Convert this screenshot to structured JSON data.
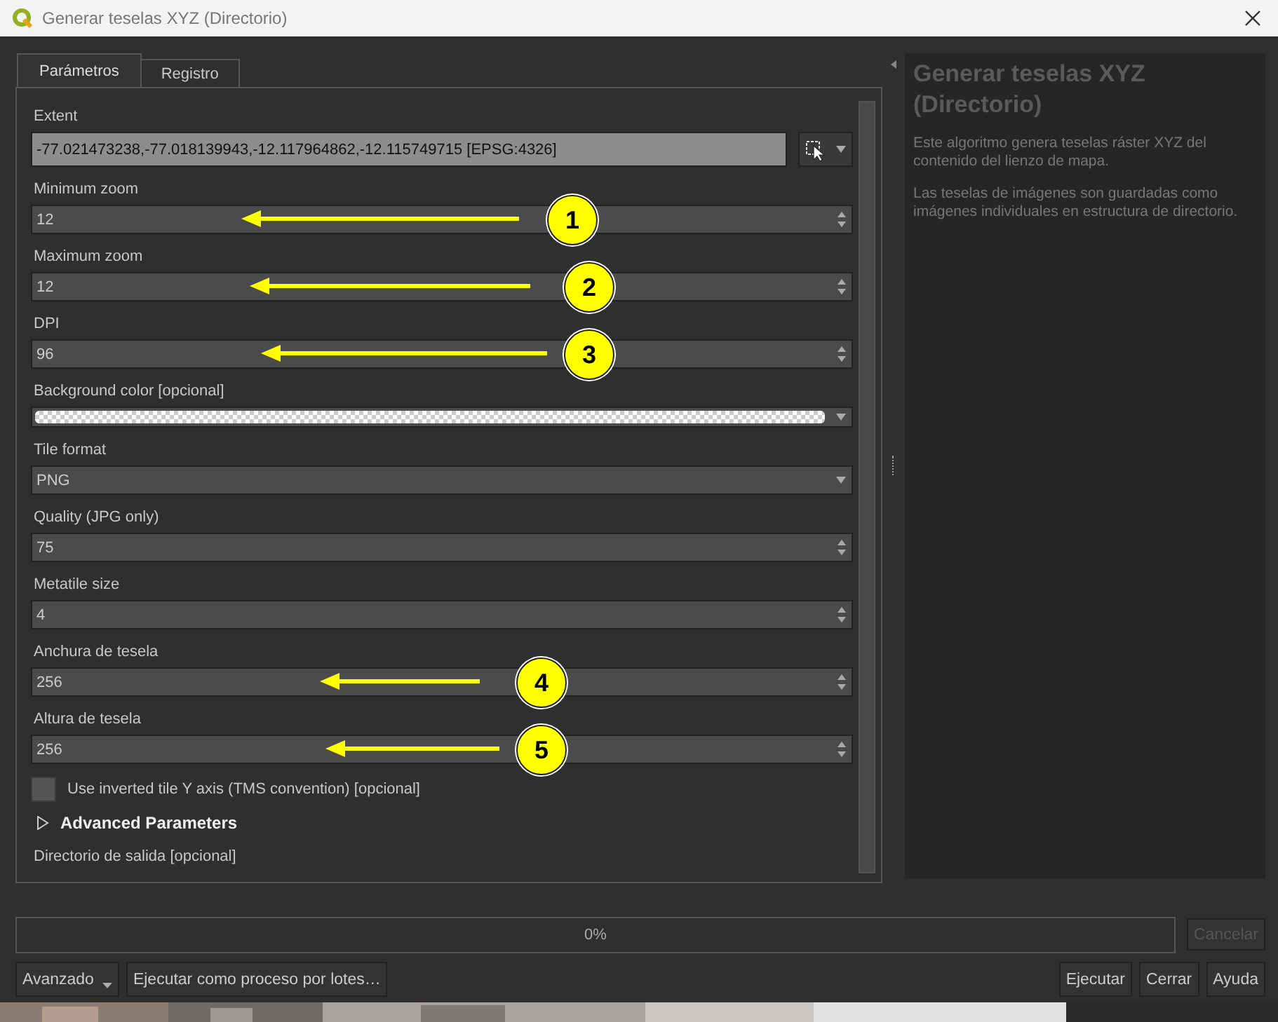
{
  "window": {
    "title": "Generar teselas XYZ (Directorio)"
  },
  "tabs": [
    {
      "label": "Parámetros",
      "selected": true
    },
    {
      "label": "Registro",
      "selected": false
    }
  ],
  "parameters": [
    {
      "label": "Extent",
      "kind": "extent",
      "value": "-77.021473238,-77.018139943,-12.117964862,-12.115749715 [EPSG:4326]"
    },
    {
      "label": "Minimum zoom",
      "kind": "spin",
      "value": "12",
      "annotation": "1"
    },
    {
      "label": "Maximum zoom",
      "kind": "spin",
      "value": "12",
      "annotation": "2"
    },
    {
      "label": "DPI",
      "kind": "spin",
      "value": "96",
      "annotation": "3"
    },
    {
      "label": "Background color [opcional]",
      "kind": "color"
    },
    {
      "label": "Tile format",
      "kind": "combo",
      "value": "PNG"
    },
    {
      "label": "Quality (JPG only)",
      "kind": "spin",
      "value": "75"
    },
    {
      "label": "Metatile size",
      "kind": "spin",
      "value": "4"
    },
    {
      "label": "Anchura de tesela",
      "kind": "spin",
      "value": "256",
      "annotation": "4"
    },
    {
      "label": "Altura de tesela",
      "kind": "spin",
      "value": "256",
      "annotation": "5"
    }
  ],
  "inverted_axis": {
    "label": "Use inverted tile Y axis (TMS convention) [opcional]",
    "checked": false
  },
  "advanced": {
    "label": "Advanced Parameters",
    "expanded": false
  },
  "output_label": "Directorio de salida [opcional]",
  "progress": {
    "label": "0%",
    "level": 0
  },
  "cancel": {
    "label": "Cancelar",
    "disabled": true
  },
  "buttons_left": [
    {
      "label": "Avanzado",
      "kind": "menu"
    },
    {
      "label": "Ejecutar como proceso por lotes…",
      "kind": "plain"
    }
  ],
  "buttons_right": [
    "Ejecutar",
    "Cerrar",
    "Ayuda"
  ],
  "help": {
    "title": "Generar teselas XYZ (Directorio)",
    "paragraphs": [
      "Este algoritmo genera teselas ráster XYZ del contenido del lienzo de mapa.",
      "Las teselas de imágenes son guardadas como imágenes individuales en estructura de directorio."
    ]
  }
}
